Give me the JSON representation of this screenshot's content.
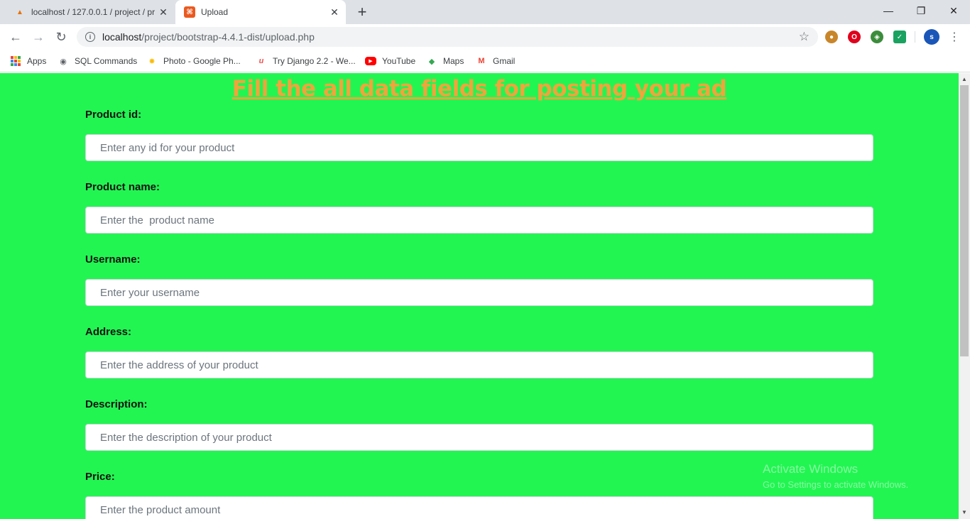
{
  "browser": {
    "tabs": [
      {
        "title": "localhost / 127.0.0.1 / project / pr",
        "icon": "phpmyadmin-icon"
      },
      {
        "title": "Upload",
        "icon": "upload-favicon"
      }
    ],
    "url_host": "localhost",
    "url_path": "/project/bootstrap-4.4.1-dist/upload.php",
    "avatar_letter": "s"
  },
  "bookmarks": [
    {
      "label": "Apps",
      "icon": "apps-grid-icon"
    },
    {
      "label": "SQL Commands",
      "icon": "globe-icon"
    },
    {
      "label": "Photo - Google Ph...",
      "icon": "google-photos-icon"
    },
    {
      "label": "Try Django 2.2 - We...",
      "icon": "udemy-icon"
    },
    {
      "label": "YouTube",
      "icon": "youtube-icon"
    },
    {
      "label": "Maps",
      "icon": "maps-icon"
    },
    {
      "label": "Gmail",
      "icon": "gmail-icon"
    }
  ],
  "form": {
    "heading": "Fill the all data fields for posting your ad",
    "fields": [
      {
        "label": "Product id:",
        "placeholder": "Enter any id for your product"
      },
      {
        "label": "Product name:",
        "placeholder": "Enter the  product name"
      },
      {
        "label": "Username:",
        "placeholder": "Enter your username"
      },
      {
        "label": "Address:",
        "placeholder": "Enter the address of your product"
      },
      {
        "label": "Description:",
        "placeholder": "Enter the description of your product"
      },
      {
        "label": "Price:",
        "placeholder": "Enter the product amount"
      }
    ]
  },
  "watermark": {
    "line1": "Activate Windows",
    "line2": "Go to Settings to activate Windows."
  },
  "colors": {
    "page_background": "#22f552",
    "heading": "#f0a43c"
  }
}
